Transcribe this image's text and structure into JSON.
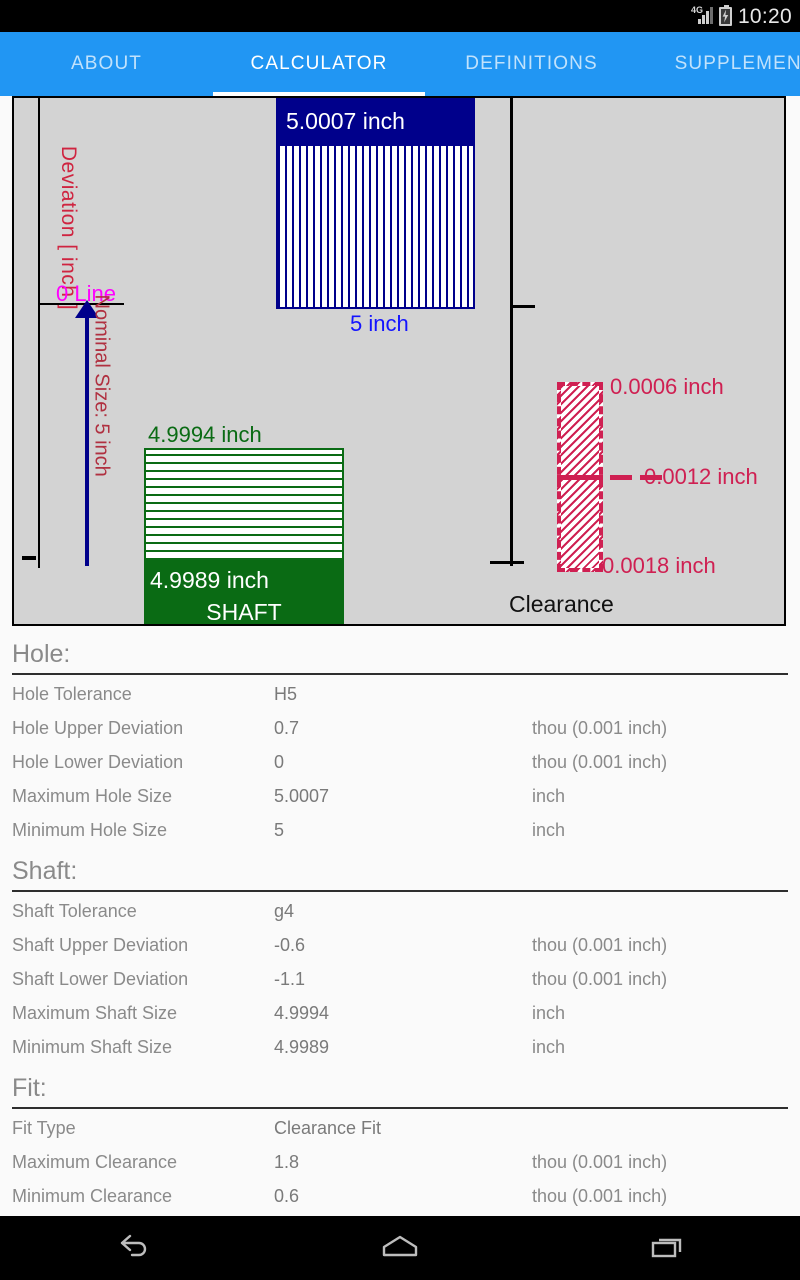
{
  "statusbar": {
    "network_label": "4G",
    "time": "10:20",
    "signal_icon": "signal-bars-icon",
    "battery_icon": "battery-charging-icon"
  },
  "tabs": [
    {
      "label": "ABOUT",
      "active": false
    },
    {
      "label": "CALCULATOR",
      "active": true
    },
    {
      "label": "DEFINITIONS",
      "active": false
    },
    {
      "label": "SUPPLEMENT",
      "active": false
    }
  ],
  "diagram": {
    "y_axis_label": "Deviation [ inch ]",
    "zero_line_label": "0 Line",
    "nominal_label": "Nominal Size: 5 inch",
    "hole": {
      "max_label": "5.0007 inch",
      "nominal_label": "5 inch"
    },
    "shaft": {
      "max_label": "4.9994 inch",
      "min_label": "4.9989 inch",
      "name": "SHAFT"
    },
    "clearance": {
      "title": "Clearance",
      "min_label": "0.0006 inch",
      "mid_label": "0.0012 inch",
      "max_label": "0.0018 inch"
    },
    "colors": {
      "hole": "#00008b",
      "shaft": "#0a6b14",
      "clearance": "#cf2052",
      "zero_line": "#ff00ff",
      "axis_label": "#cf2440",
      "background": "#d3d3d3"
    }
  },
  "sections": [
    {
      "title": "Hole:",
      "rows": [
        {
          "label": "Hole Tolerance",
          "value": "H5",
          "unit": ""
        },
        {
          "label": "Hole Upper Deviation",
          "value": "0.7",
          "unit": "thou (0.001 inch)"
        },
        {
          "label": "Hole Lower Deviation",
          "value": "0",
          "unit": "thou (0.001 inch)"
        },
        {
          "label": "Maximum Hole Size",
          "value": "5.0007",
          "unit": "inch"
        },
        {
          "label": "Minimum Hole Size",
          "value": "5",
          "unit": "inch"
        }
      ]
    },
    {
      "title": "Shaft:",
      "rows": [
        {
          "label": "Shaft Tolerance",
          "value": "g4",
          "unit": ""
        },
        {
          "label": "Shaft Upper Deviation",
          "value": "-0.6",
          "unit": "thou (0.001 inch)"
        },
        {
          "label": "Shaft Lower Deviation",
          "value": "-1.1",
          "unit": "thou (0.001 inch)"
        },
        {
          "label": "Maximum Shaft Size",
          "value": "4.9994",
          "unit": "inch"
        },
        {
          "label": "Minimum Shaft Size",
          "value": "4.9989",
          "unit": "inch"
        }
      ]
    },
    {
      "title": "Fit:",
      "rows": [
        {
          "label": "Fit Type",
          "value": "Clearance Fit",
          "unit": ""
        },
        {
          "label": "Maximum Clearance",
          "value": "1.8",
          "unit": "thou (0.001 inch)"
        },
        {
          "label": "Minimum Clearance",
          "value": "0.6",
          "unit": "thou (0.001 inch)"
        }
      ]
    }
  ],
  "navbar": {
    "back": "back-icon",
    "home": "home-icon",
    "recents": "recent-apps-icon"
  }
}
